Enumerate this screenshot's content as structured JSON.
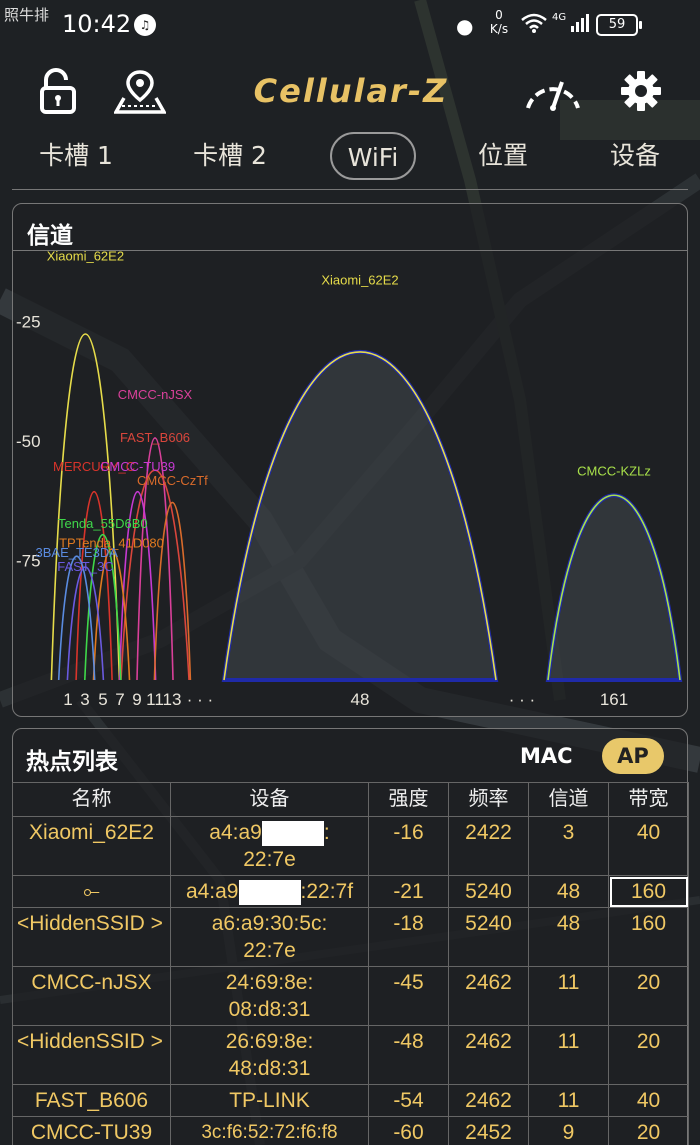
{
  "status_bar": {
    "watermark": "照牛排",
    "time": "10:42",
    "speed_value": "0",
    "speed_unit": "K/s",
    "network": "4G",
    "battery": "59",
    "icons": [
      "sound-wave-icon",
      "location-pin-icon",
      "wifi-icon",
      "signal-icon",
      "battery-icon"
    ]
  },
  "toolbar": {
    "app_title": "Cellular-Z",
    "icons": [
      "unlock-icon",
      "map-location-icon",
      "speedometer-icon",
      "gear-icon"
    ]
  },
  "tabs": [
    {
      "label": "卡槽 1",
      "active": false
    },
    {
      "label": "卡槽 2",
      "active": false
    },
    {
      "label": "WiFi",
      "active": true
    },
    {
      "label": "位置",
      "active": false
    },
    {
      "label": "设备",
      "active": false
    }
  ],
  "channel_panel": {
    "title": "信道"
  },
  "chart_data": {
    "type": "area",
    "y_ticks": [
      "-25",
      "-50",
      "-75"
    ],
    "ylim": [
      -100,
      -10
    ],
    "x_ticks": [
      "1",
      "3",
      "5",
      "7",
      "9",
      "11",
      "13",
      "· · ·",
      "48",
      "· · ·",
      "161"
    ],
    "grid": false,
    "series": [
      {
        "name": "Xiaomi_62E2",
        "channel": 3,
        "rssi": -16,
        "width": 40,
        "color": "#e6dc4a"
      },
      {
        "name": "Xiaomi_62E2",
        "channel": 48,
        "rssi": -21,
        "width": 160,
        "color": "#e6dc4a"
      },
      {
        "name": "CMCC-nJSX",
        "channel": 11,
        "rssi": -45,
        "width": 20,
        "color": "#d9409a"
      },
      {
        "name": "FAST_B606",
        "channel": 11,
        "rssi": -54,
        "width": 40,
        "color": "#d9463c"
      },
      {
        "name": "MERCURY_C",
        "channel": 4,
        "rssi": -60,
        "width": 20,
        "color": "#d9342b"
      },
      {
        "name": "CMCC-TU39",
        "channel": 9,
        "rssi": -60,
        "width": 20,
        "color": "#c63ad2"
      },
      {
        "name": "CMCC-CzTf",
        "channel": 13,
        "rssi": -63,
        "width": 20,
        "color": "#d96b2b"
      },
      {
        "name": "Tenda_55D6B0",
        "channel": 5,
        "rssi": -72,
        "width": 20,
        "color": "#3fd84a"
      },
      {
        "name": "TPTenda_41D080",
        "channel": 6,
        "rssi": -76,
        "width": 20,
        "color": "#e07a20"
      },
      {
        "name": "3BAE_TE3DA",
        "channel": 2,
        "rssi": -78,
        "width": 20,
        "color": "#5a8be0"
      },
      {
        "name": "FAST_3C",
        "channel": 3,
        "rssi": -81,
        "width": 20,
        "color": "#6a5ae0"
      },
      {
        "name": "CMCC-KZLz",
        "channel": 161,
        "rssi": -61,
        "width": 40,
        "color": "#a8e04a"
      }
    ]
  },
  "hotspot_list": {
    "title": "热点列表",
    "mac_label": "MAC",
    "ap_label": "AP",
    "columns": [
      "名称",
      "设备",
      "强度",
      "频率",
      "信道",
      "带宽"
    ],
    "rows": [
      {
        "name": "Xiaomi_62E2",
        "device_a": "a4:a9",
        "device_b": ":",
        "device_c": "22:7e",
        "redacted": true,
        "strength": "-16",
        "freq": "2422",
        "channel": "3",
        "bw": "40"
      },
      {
        "name": "⟜",
        "device_a": "a4:a9",
        "device_b": ":22:7f",
        "device_c": "",
        "redacted": true,
        "strength": "-21",
        "freq": "5240",
        "channel": "48",
        "bw": "160"
      },
      {
        "name": "<HiddenSSID >",
        "device_a": "a6:a9:30:5c:",
        "device_b": "",
        "device_c": "22:7e",
        "redacted": false,
        "strength": "-18",
        "freq": "5240",
        "channel": "48",
        "bw": "160"
      },
      {
        "name": "CMCC-nJSX",
        "device_a": "24:69:8e:",
        "device_b": "",
        "device_c": "08:d8:31",
        "redacted": false,
        "strength": "-45",
        "freq": "2462",
        "channel": "11",
        "bw": "20"
      },
      {
        "name": "<HiddenSSID >",
        "device_a": "26:69:8e:",
        "device_b": "",
        "device_c": "48:d8:31",
        "redacted": false,
        "strength": "-48",
        "freq": "2462",
        "channel": "11",
        "bw": "20"
      },
      {
        "name": "FAST_B606",
        "device_a": "TP-LINK",
        "device_b": "",
        "device_c": "",
        "redacted": false,
        "strength": "-54",
        "freq": "2462",
        "channel": "11",
        "bw": "40"
      },
      {
        "name": "CMCC-TU39",
        "device_a": "3c:f6:52:72:f6:f8",
        "device_b": "",
        "device_c": "",
        "redacted": false,
        "strength": "-60",
        "freq": "2452",
        "channel": "9",
        "bw": "20"
      }
    ]
  }
}
